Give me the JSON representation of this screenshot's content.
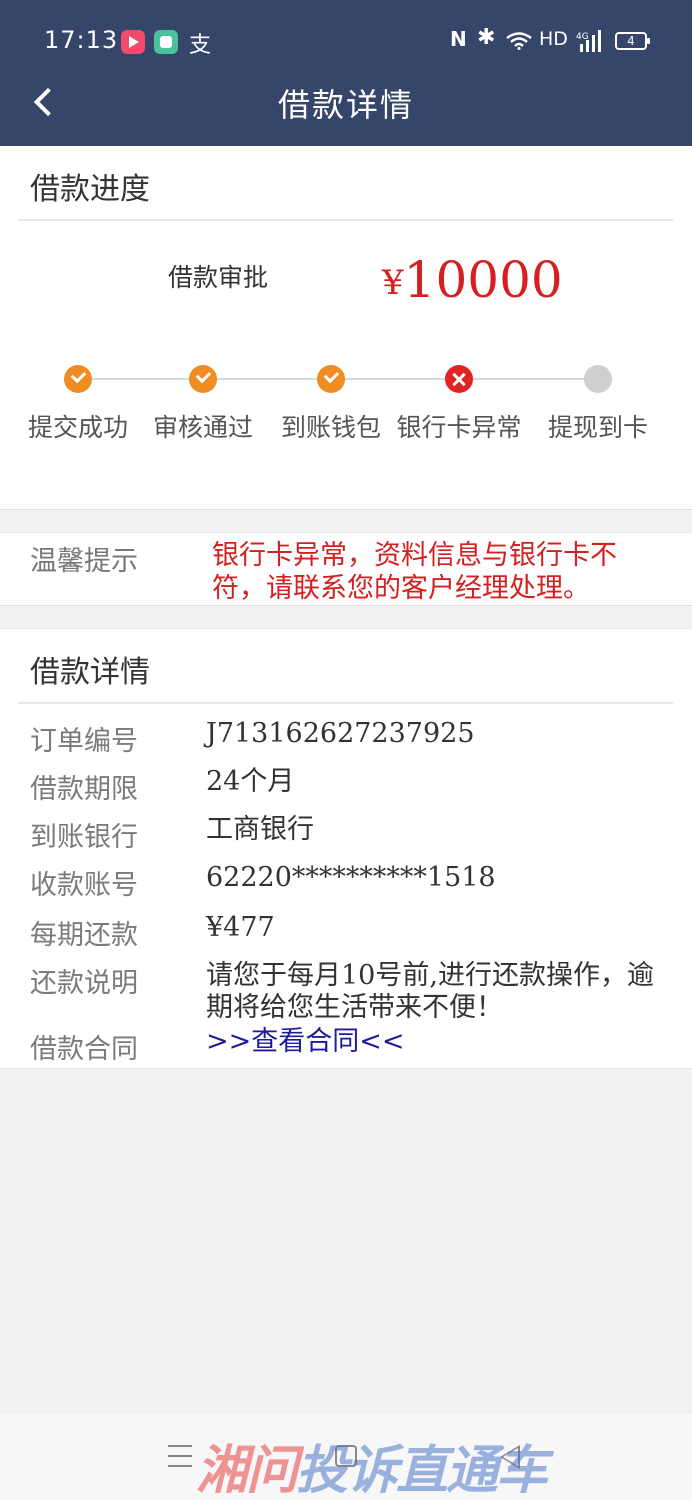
{
  "status_bar": {
    "time": "17:13",
    "app3": "支",
    "nfc": "N",
    "bluetooth": "✱",
    "network": "HD",
    "signal": "4G",
    "battery": "4"
  },
  "header": {
    "title": "借款详情"
  },
  "progress": {
    "section_title": "借款进度",
    "approval_label": "借款审批",
    "currency": "¥",
    "amount": "10000",
    "steps": [
      {
        "label": "提交成功",
        "state": "done"
      },
      {
        "label": "审核通过",
        "state": "done"
      },
      {
        "label": "到账钱包",
        "state": "done"
      },
      {
        "label": "银行卡异常",
        "state": "error"
      },
      {
        "label": "提现到卡",
        "state": "pending"
      }
    ]
  },
  "tip": {
    "label": "温馨提示",
    "text": "银行卡异常，资料信息与银行卡不符，请联系您的客户经理处理。"
  },
  "details": {
    "section_title": "借款详情",
    "rows": [
      {
        "label": "订单编号",
        "value": "J713162627237925"
      },
      {
        "label": "借款期限",
        "value": "24个月"
      },
      {
        "label": "到账银行",
        "value": "工商银行"
      },
      {
        "label": "收款账号",
        "value": "62220**********1518"
      },
      {
        "label": "每期还款",
        "value": "¥477"
      },
      {
        "label": "还款说明",
        "value": "请您于每月10号前,进行还款操作，逾期将给您生活带来不便！"
      },
      {
        "label": "借款合同",
        "value": ">>查看合同<<"
      }
    ]
  },
  "watermark": {
    "part1": "湘问",
    "part2": "投诉直通车"
  },
  "colors": {
    "header_bg": "#36466a",
    "accent_red": "#d42020",
    "step_done": "#f08c22",
    "step_error": "#e02424",
    "step_pending": "#cfcfcf",
    "link": "#1c1c9c"
  }
}
